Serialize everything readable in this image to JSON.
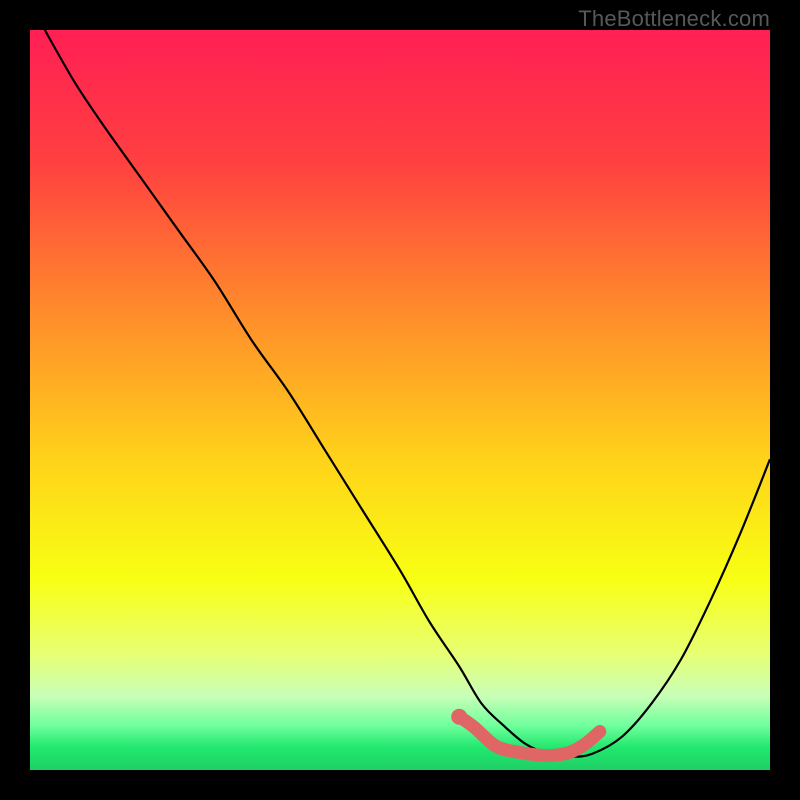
{
  "attribution": "TheBottleneck.com",
  "chart_data": {
    "type": "line",
    "title": "",
    "xlabel": "",
    "ylabel": "",
    "xlim": [
      0,
      100
    ],
    "ylim": [
      0,
      100
    ],
    "gradient_stops": [
      {
        "offset": 0,
        "color": "#ff1f54"
      },
      {
        "offset": 18,
        "color": "#ff4040"
      },
      {
        "offset": 38,
        "color": "#ff8b2b"
      },
      {
        "offset": 58,
        "color": "#ffd21a"
      },
      {
        "offset": 74,
        "color": "#f8ff13"
      },
      {
        "offset": 84,
        "color": "#e8ff70"
      },
      {
        "offset": 90,
        "color": "#c8ffb8"
      },
      {
        "offset": 94,
        "color": "#6fff9c"
      },
      {
        "offset": 97,
        "color": "#20e86e"
      },
      {
        "offset": 100,
        "color": "#1fcf66"
      }
    ],
    "series": [
      {
        "name": "bottleneck-curve",
        "x": [
          2,
          6,
          10,
          15,
          20,
          25,
          30,
          35,
          40,
          45,
          50,
          54,
          58,
          61,
          64,
          67,
          70,
          73,
          76,
          80,
          84,
          88,
          92,
          96,
          100
        ],
        "y": [
          100,
          93,
          87,
          80,
          73,
          66,
          58,
          51,
          43,
          35,
          27,
          20,
          14,
          9,
          6,
          3.5,
          2.2,
          1.8,
          2.2,
          4.5,
          9,
          15,
          23,
          32,
          42
        ]
      }
    ],
    "optimal_segment": {
      "name": "optimal-zone",
      "points": [
        {
          "x": 58,
          "y": 7.2
        },
        {
          "x": 60,
          "y": 5.8
        },
        {
          "x": 63,
          "y": 3.2
        },
        {
          "x": 66,
          "y": 2.4
        },
        {
          "x": 69,
          "y": 2.0
        },
        {
          "x": 71,
          "y": 2.0
        },
        {
          "x": 73,
          "y": 2.4
        },
        {
          "x": 75,
          "y": 3.5
        },
        {
          "x": 77,
          "y": 5.2
        }
      ],
      "dot": {
        "x": 58,
        "y": 7.2
      },
      "color": "#e06666"
    }
  }
}
